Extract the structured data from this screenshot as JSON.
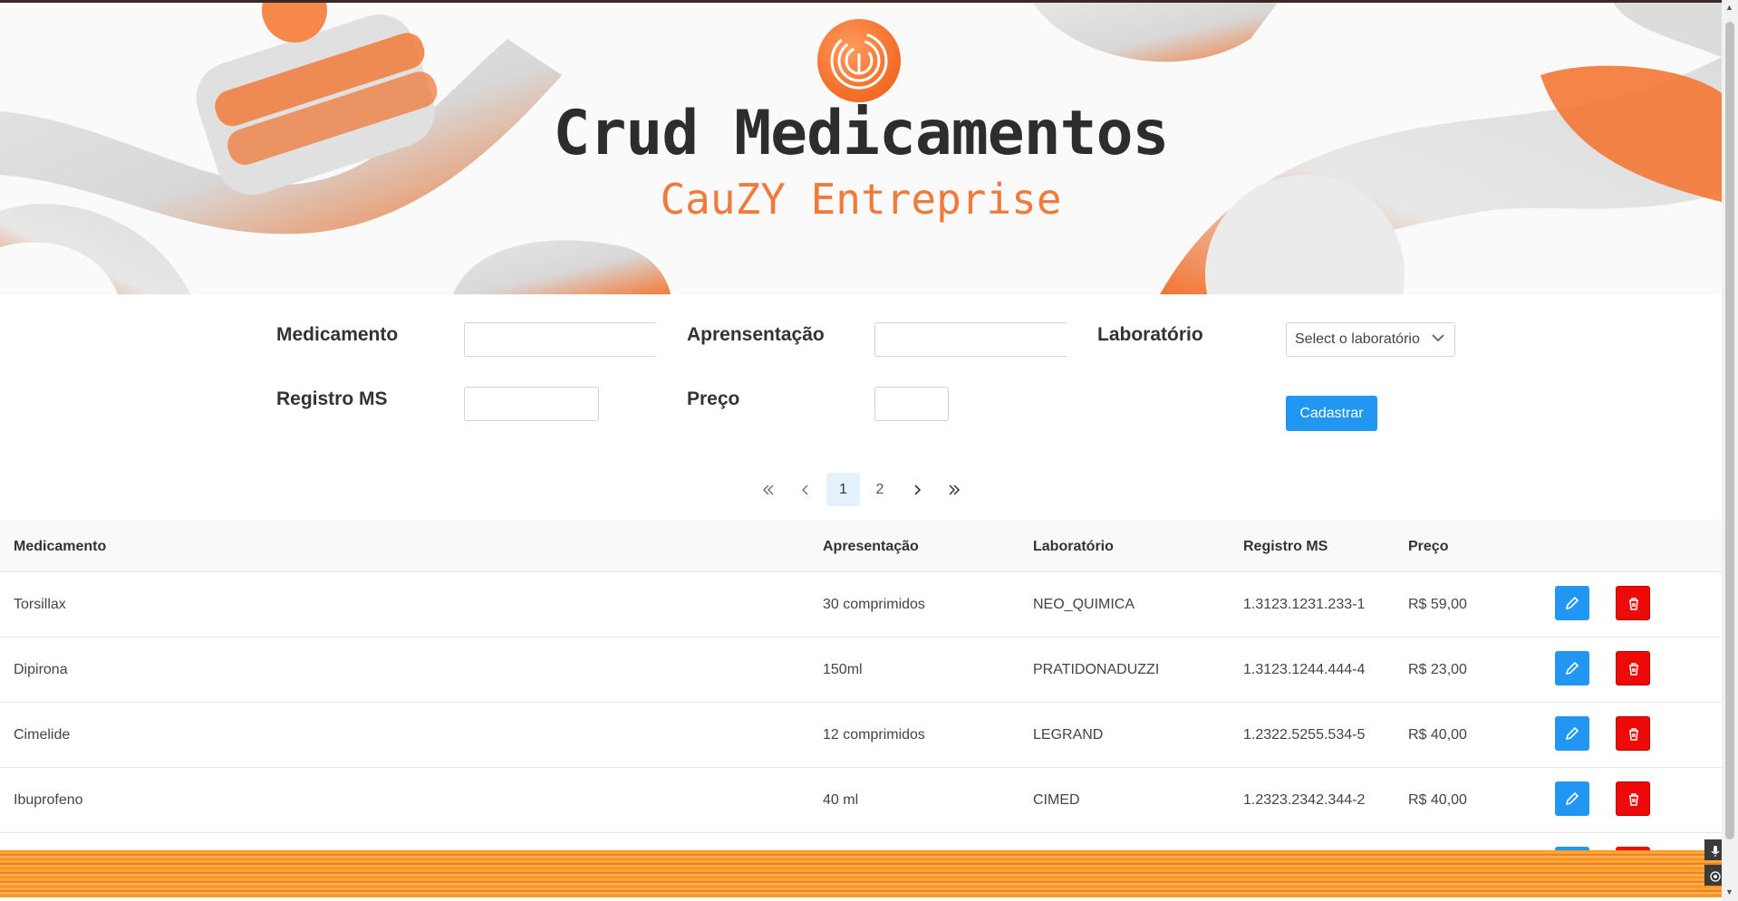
{
  "header": {
    "title": "Crud Medicamentos",
    "subtitle": "CauZY Entreprise",
    "logo_icon": "fingerprint-c-icon"
  },
  "form": {
    "medicamento_label": "Medicamento",
    "medicamento_value": "",
    "apresentacao_label": "Aprensentação",
    "apresentacao_value": "",
    "laboratorio_label": "Laboratório",
    "laboratorio_select": "Select o laboratório",
    "registro_label": "Registro MS",
    "registro_value": "",
    "preco_label": "Preço",
    "preco_value": "",
    "submit_label": "Cadastrar"
  },
  "pagination": {
    "first": "«",
    "prev": "‹",
    "pages": [
      "1",
      "2"
    ],
    "current": "1",
    "next": "›",
    "last": "»"
  },
  "table": {
    "columns": [
      "Medicamento",
      "Apresentação",
      "Laboratório",
      "Registro MS",
      "Preço"
    ],
    "rows": [
      {
        "medicamento": "Torsillax",
        "apresentacao": "30 comprimidos",
        "laboratorio": "NEO_QUIMICA",
        "registro": "1.3123.1231.233-1",
        "preco": "R$ 59,00"
      },
      {
        "medicamento": "Dipirona",
        "apresentacao": "150ml",
        "laboratorio": "PRATIDONADUZZI",
        "registro": "1.3123.1244.444-4",
        "preco": "R$ 23,00"
      },
      {
        "medicamento": "Cimelide",
        "apresentacao": "12 comprimidos",
        "laboratorio": "LEGRAND",
        "registro": "1.2322.5255.534-5",
        "preco": "R$ 40,00"
      },
      {
        "medicamento": "Ibuprofeno",
        "apresentacao": "40 ml",
        "laboratorio": "CIMED",
        "registro": "1.2323.2342.344-2",
        "preco": "R$ 40,00"
      }
    ],
    "edit_icon": "pencil-icon",
    "delete_icon": "trash-icon"
  },
  "colors": {
    "accent_blue": "#2196f3",
    "danger_red": "#ef0a0a",
    "brand_orange": "#f07a3a"
  }
}
